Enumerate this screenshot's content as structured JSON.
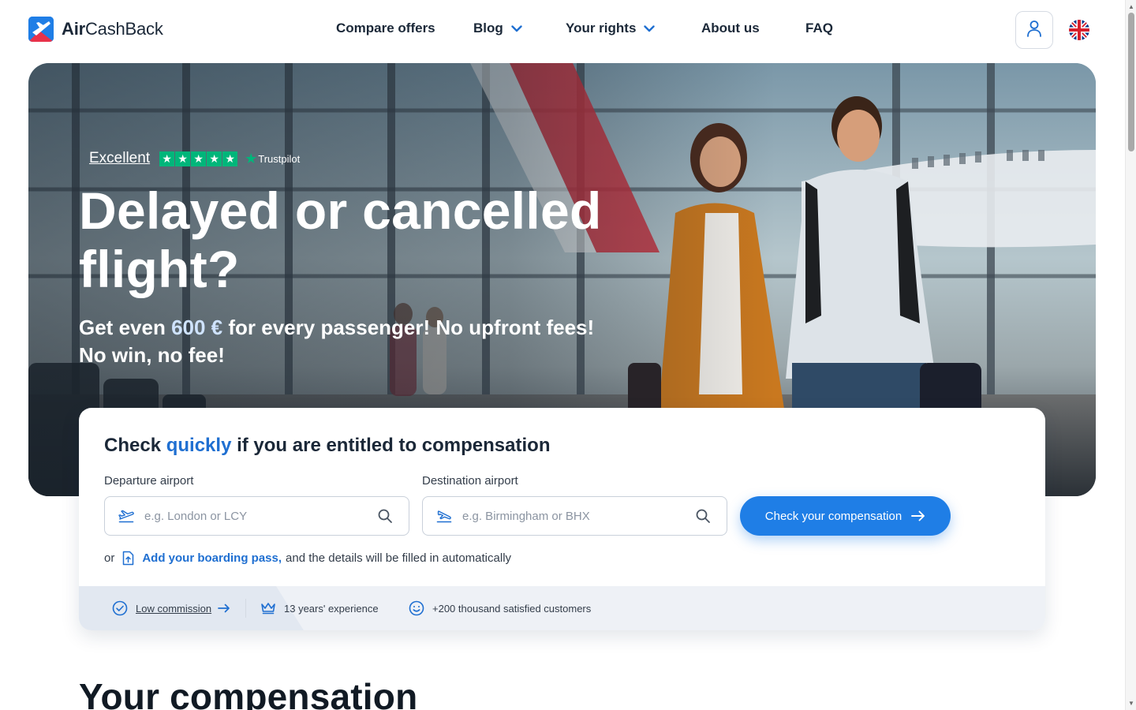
{
  "brand": {
    "name_bold": "Air",
    "name_regular": "CashBack",
    "primary_color": "#1f7ee6",
    "accent_color": "#1f6fd1",
    "logo_icon": "plane-logo-icon"
  },
  "nav": {
    "items": [
      {
        "label": "Compare offers",
        "has_dropdown": false
      },
      {
        "label": "Blog",
        "has_dropdown": true
      },
      {
        "label": "Your rights",
        "has_dropdown": true
      },
      {
        "label": "About us",
        "has_dropdown": false
      },
      {
        "label": "FAQ",
        "has_dropdown": false
      }
    ],
    "user_icon": "user-icon",
    "language_icon": "uk-flag-icon"
  },
  "hero": {
    "rating_label": "Excellent",
    "rating_stars": 5,
    "rating_provider": "Trustpilot",
    "title": "Delayed or cancelled flight?",
    "subtitle_prefix": "Get even",
    "subtitle_amount": "600 €",
    "subtitle_suffix": "for every passenger! No upfront fees!",
    "subtitle_line2": "No win, no fee!"
  },
  "form": {
    "title_prefix": "Check",
    "title_highlight": "quickly",
    "title_suffix": "if you are entitled to compensation",
    "departure": {
      "label": "Departure airport",
      "placeholder": "e.g. London or LCY",
      "value": "",
      "icon": "takeoff-icon"
    },
    "destination": {
      "label": "Destination airport",
      "placeholder": "e.g. Birmingham or BHX",
      "value": "",
      "icon": "landing-icon"
    },
    "submit_label": "Check your compensation",
    "boarding_pass": {
      "or": "or",
      "link": "Add your boarding pass,",
      "suffix": "and the details will be filled in automatically",
      "icon": "upload-file-icon"
    }
  },
  "benefits": [
    {
      "label": "Low commission",
      "icon": "check-circle-icon",
      "is_link": true
    },
    {
      "label": "13 years' experience",
      "icon": "crown-icon",
      "is_link": false
    },
    {
      "label": "+200 thousand satisfied customers",
      "icon": "smile-icon",
      "is_link": false
    }
  ],
  "section": {
    "title": "Your compensation"
  }
}
